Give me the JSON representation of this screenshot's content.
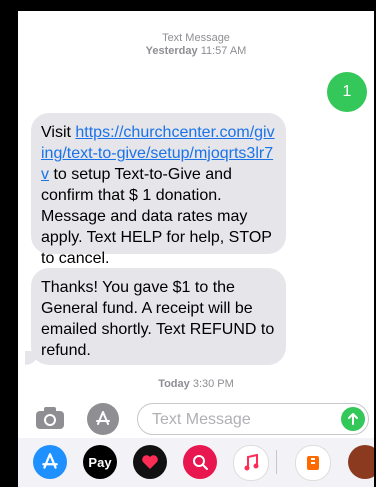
{
  "header": {
    "service": "Text Message",
    "day": "Yesterday",
    "time": "11:57 AM"
  },
  "outgoing": {
    "text": "1"
  },
  "message1": {
    "prefix": "Visit ",
    "link": "https://churchcenter.com/giving/text-to-give/setup/mjoqrts3lr7v",
    "suffix": " to setup Text-to-Give and confirm that  $ 1 donation. Message and data rates may apply. Text HELP for help, STOP to cancel."
  },
  "message2": {
    "text": "Thanks! You gave $1 to the General fund. A receipt will be emailed shortly. Text REFUND to refund."
  },
  "footer_time": {
    "day": "Today",
    "time": "3:30 PM"
  },
  "composer": {
    "placeholder": "Text Message"
  },
  "apps": {
    "applepay_label": "Pay"
  },
  "icons": [
    "camera-icon",
    "app-store-icon",
    "send-arrow-icon",
    "apple-pay-icon",
    "heart-icon",
    "search-globe-icon",
    "music-note-icon",
    "ticket-icon",
    "bible-icon"
  ],
  "colors": {
    "green": "#34c759",
    "blue": "#1a73e8",
    "bubble_gray": "#e5e5ea"
  }
}
